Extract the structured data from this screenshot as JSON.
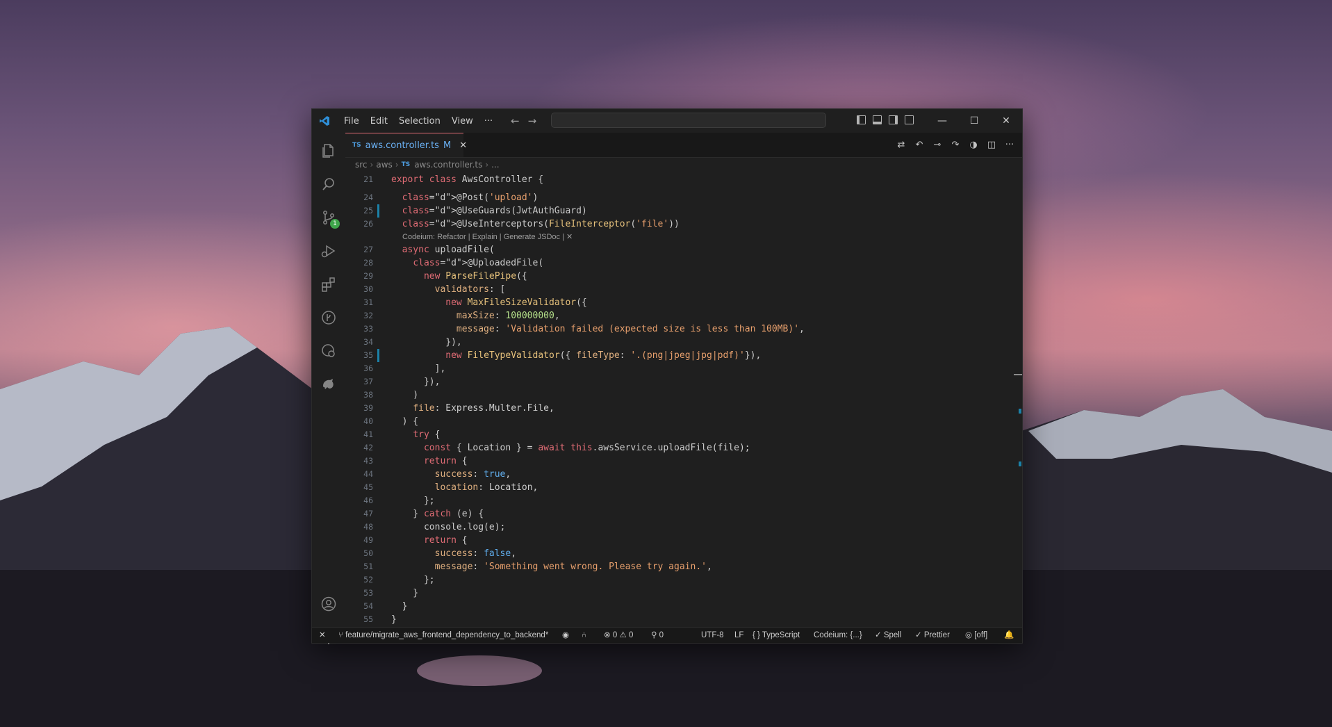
{
  "titlebar": {
    "menu": [
      "File",
      "Edit",
      "Selection",
      "View",
      "···"
    ],
    "back": "←",
    "forward": "→",
    "minimize": "—",
    "maximize": "☐",
    "close": "✕"
  },
  "tab": {
    "badge": "TS",
    "label": "aws.controller.ts",
    "modified": "M",
    "close": "✕"
  },
  "breadcrumb": {
    "src": "src",
    "aws": "aws",
    "badge": "TS",
    "file": "aws.controller.ts",
    "more": "..."
  },
  "codelens": "Codeium: Refactor | Explain | Generate JSDoc | ✕",
  "code_lines": [
    {
      "n": "21",
      "t": "export class AwsController {"
    },
    {
      "n": "24",
      "t": "  @Post('upload')"
    },
    {
      "n": "25",
      "t": "  @UseGuards(JwtAuthGuard)"
    },
    {
      "n": "26",
      "t": "  @UseInterceptors(FileInterceptor('file'))"
    },
    {
      "n": "27",
      "t": "  async uploadFile("
    },
    {
      "n": "28",
      "t": "    @UploadedFile("
    },
    {
      "n": "29",
      "t": "      new ParseFilePipe({"
    },
    {
      "n": "30",
      "t": "        validators: ["
    },
    {
      "n": "31",
      "t": "          new MaxFileSizeValidator({"
    },
    {
      "n": "32",
      "t": "            maxSize: 100000000,"
    },
    {
      "n": "33",
      "t": "            message: 'Validation failed (expected size is less than 100MB)',"
    },
    {
      "n": "34",
      "t": "          }),"
    },
    {
      "n": "35",
      "t": "          new FileTypeValidator({ fileType: '.(png|jpeg|jpg|pdf)'}),"
    },
    {
      "n": "36",
      "t": "        ],"
    },
    {
      "n": "37",
      "t": "      }),"
    },
    {
      "n": "38",
      "t": "    )"
    },
    {
      "n": "39",
      "t": "    file: Express.Multer.File,"
    },
    {
      "n": "40",
      "t": "  ) {"
    },
    {
      "n": "41",
      "t": "    try {"
    },
    {
      "n": "42",
      "t": "      const { Location } = await this.awsService.uploadFile(file);"
    },
    {
      "n": "43",
      "t": "      return {"
    },
    {
      "n": "44",
      "t": "        success: true,"
    },
    {
      "n": "45",
      "t": "        location: Location,"
    },
    {
      "n": "46",
      "t": "      };"
    },
    {
      "n": "47",
      "t": "    } catch (e) {"
    },
    {
      "n": "48",
      "t": "      console.log(e);"
    },
    {
      "n": "49",
      "t": "      return {"
    },
    {
      "n": "50",
      "t": "        success: false,"
    },
    {
      "n": "51",
      "t": "        message: 'Something went wrong. Please try again.',"
    },
    {
      "n": "52",
      "t": "      };"
    },
    {
      "n": "53",
      "t": "    }"
    },
    {
      "n": "54",
      "t": "  }"
    },
    {
      "n": "55",
      "t": "}"
    }
  ],
  "source_control_badge": "1",
  "statusbar": {
    "remote": "✕",
    "branch": "feature/migrate_aws_frontend_dependency_to_backend*",
    "errors": "0",
    "warnings": "0",
    "ports": "0",
    "encoding": "UTF-8",
    "eol": "LF",
    "language": "TypeScript",
    "codeium": "Codeium: {...}",
    "spell": "Spell",
    "prettier": "Prettier",
    "off": "[off]"
  },
  "colors": {
    "accent_tab": "#e06c75",
    "git_modified": "#1b81a8",
    "badge_green": "#3fa64b"
  }
}
